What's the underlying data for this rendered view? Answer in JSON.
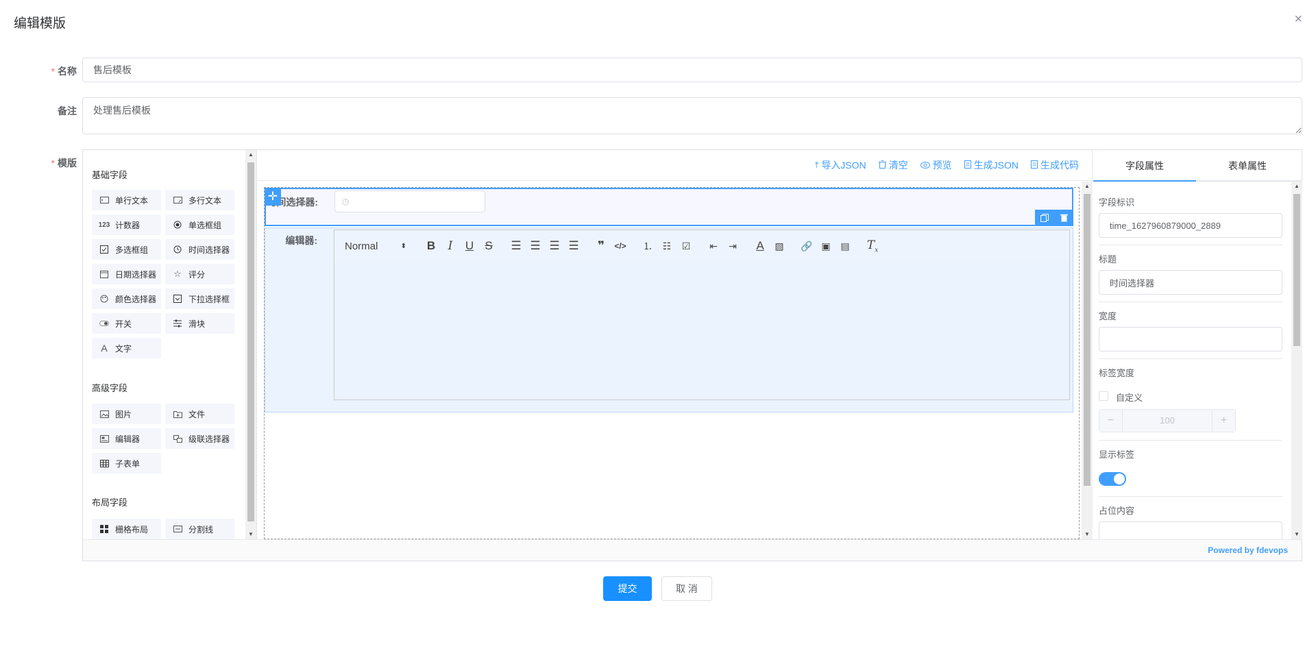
{
  "dialog": {
    "title": "编辑模版",
    "close_icon": "×"
  },
  "form": {
    "name_label": "名称",
    "name_value": "售后模板",
    "remark_label": "备注",
    "remark_value": "处理售后模板",
    "template_label": "模版",
    "required_mark": "*"
  },
  "components": {
    "basic_title": "基础字段",
    "basic": [
      {
        "label": "单行文本",
        "icon": "input-icon"
      },
      {
        "label": "多行文本",
        "icon": "textarea-icon"
      },
      {
        "label": "计数器",
        "icon": "number-icon"
      },
      {
        "label": "单选框组",
        "icon": "radio-icon"
      },
      {
        "label": "多选框组",
        "icon": "checkbox-icon"
      },
      {
        "label": "时间选择器",
        "icon": "clock-icon"
      },
      {
        "label": "日期选择器",
        "icon": "calendar-icon"
      },
      {
        "label": "评分",
        "icon": "star-icon"
      },
      {
        "label": "颜色选择器",
        "icon": "palette-icon"
      },
      {
        "label": "下拉选择框",
        "icon": "select-icon"
      },
      {
        "label": "开关",
        "icon": "switch-icon"
      },
      {
        "label": "滑块",
        "icon": "slider-icon"
      },
      {
        "label": "文字",
        "icon": "text-icon"
      }
    ],
    "advanced_title": "高级字段",
    "advanced": [
      {
        "label": "图片",
        "icon": "image-icon"
      },
      {
        "label": "文件",
        "icon": "file-icon"
      },
      {
        "label": "编辑器",
        "icon": "editor-icon"
      },
      {
        "label": "级联选择器",
        "icon": "cascader-icon"
      },
      {
        "label": "子表单",
        "icon": "table-icon"
      }
    ],
    "layout_title": "布局字段",
    "layout": [
      {
        "label": "栅格布局",
        "icon": "grid-icon"
      },
      {
        "label": "分割线",
        "icon": "divider-icon"
      }
    ]
  },
  "toolbar": {
    "import_json": "导入JSON",
    "clear": "清空",
    "preview": "预览",
    "gen_json": "生成JSON",
    "gen_code": "生成代码"
  },
  "canvas": {
    "time_label": "时间选择器:",
    "editor_label": "编辑器:",
    "editor_header_select": "Normal"
  },
  "props": {
    "tab_field": "字段属性",
    "tab_form": "表单属性",
    "field_id_label": "字段标识",
    "field_id_value": "time_1627960879000_2889",
    "title_label": "标题",
    "title_value": "时间选择器",
    "width_label": "宽度",
    "width_value": "",
    "label_width_label": "标签宽度",
    "custom_label": "自定义",
    "label_width_value": "100",
    "show_label_label": "显示标签",
    "show_label_on": true,
    "placeholder_label": "占位内容"
  },
  "footer": {
    "powered": "Powered by fdevops"
  },
  "actions": {
    "submit": "提交",
    "cancel": "取 消"
  },
  "colors": {
    "primary": "#409eff",
    "submit": "#1890ff",
    "required": "#f56c6c"
  }
}
